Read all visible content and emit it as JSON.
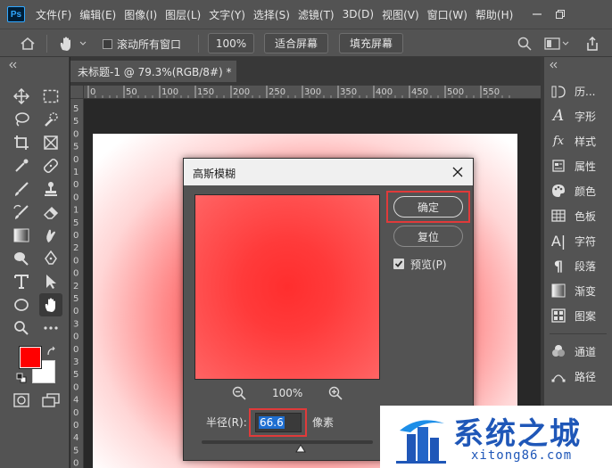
{
  "app": {
    "logo": "Ps",
    "menu": [
      "文件(F)",
      "编辑(E)",
      "图像(I)",
      "图层(L)",
      "文字(Y)",
      "选择(S)",
      "滤镜(T)",
      "3D(D)",
      "视图(V)",
      "窗口(W)",
      "帮助(H)"
    ]
  },
  "options_bar": {
    "scroll_all_label": "滚动所有窗口",
    "zoom_value": "100%",
    "fit_screen_label": "适合屏幕",
    "fill_screen_label": "填充屏幕"
  },
  "document": {
    "tab_title": "未标题-1 @ 79.3%(RGB/8#) *",
    "ruler_h": [
      "0",
      "50",
      "100",
      "150",
      "200",
      "250",
      "300",
      "350",
      "400",
      "450",
      "500",
      "550"
    ],
    "ruler_v": [
      "5",
      "5",
      "0",
      "5",
      "0",
      "1",
      "0",
      "0",
      "1",
      "5",
      "0",
      "2",
      "0",
      "0",
      "2",
      "5",
      "0",
      "3",
      "0",
      "0",
      "3",
      "5",
      "0",
      "4",
      "0",
      "0",
      "4",
      "5",
      "0"
    ]
  },
  "tools": {
    "foreground_color": "#ff0000",
    "background_color": "#ffffff"
  },
  "panels": [
    {
      "icon": "history-icon",
      "label": "历..."
    },
    {
      "icon": "character-icon",
      "label": "字形"
    },
    {
      "icon": "styles-icon",
      "label": "样式"
    },
    {
      "icon": "properties-icon",
      "label": "属性"
    },
    {
      "icon": "color-icon",
      "label": "颜色"
    },
    {
      "icon": "swatches-icon",
      "label": "色板"
    },
    {
      "icon": "char-icon",
      "label": "字符"
    },
    {
      "icon": "paragraph-icon",
      "label": "段落"
    },
    {
      "icon": "gradient-icon",
      "label": "渐变"
    },
    {
      "icon": "patterns-icon",
      "label": "图案"
    },
    {
      "icon": "channels-icon",
      "label": "通道"
    },
    {
      "icon": "paths-icon",
      "label": "路径"
    }
  ],
  "dialog": {
    "title": "高斯模糊",
    "ok_label": "确定",
    "reset_label": "复位",
    "preview_label": "预览(P)",
    "preview_checked": true,
    "zoom_label": "100%",
    "radius_label": "半径(R):",
    "radius_value": "66.6",
    "radius_unit": "像素",
    "accent_color": "#e03a3a"
  },
  "watermark": {
    "title": "系统之城",
    "url": "xitong86.com"
  }
}
